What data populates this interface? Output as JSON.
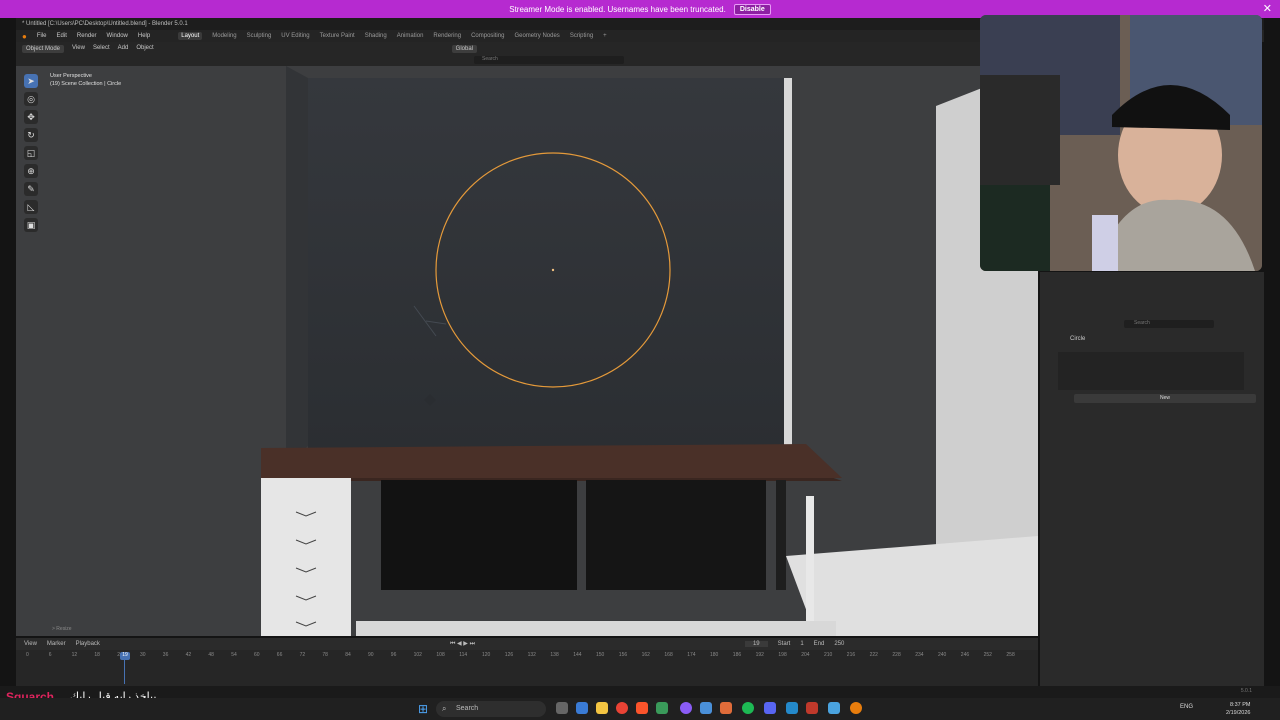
{
  "streamer": {
    "message": "Streamer Mode is enabled. Usernames have been truncated.",
    "disable_label": "Disable"
  },
  "window": {
    "title": "* Untitled [C:\\Users\\PC\\Desktop\\Untitled.blend] - Blender 5.0.1"
  },
  "menu": {
    "items": [
      "File",
      "Edit",
      "Render",
      "Window",
      "Help"
    ]
  },
  "workspaces": [
    "Layout",
    "Modeling",
    "Sculpting",
    "UV Editing",
    "Texture Paint",
    "Shading",
    "Animation",
    "Rendering",
    "Compositing",
    "Geometry Nodes",
    "Scripting"
  ],
  "viewport_header": {
    "mode": "Object Mode",
    "menus": [
      "View",
      "Select",
      "Add",
      "Object"
    ],
    "orientation": "Global",
    "search_placeholder": "Search"
  },
  "viewport": {
    "perspective": "User Perspective",
    "collection": "(19) Scene Collection | Circle",
    "bottom_label": "> Resize"
  },
  "properties": {
    "object_name": "Circle",
    "new_label": "New",
    "search_placeholder": "Search"
  },
  "timeline": {
    "menus": [
      "View",
      "Marker",
      "Playback"
    ],
    "current_frame": "19",
    "start_label": "Start",
    "start_value": "1",
    "end_label": "End",
    "end_value": "250",
    "ticks": [
      "0",
      "6",
      "12",
      "18",
      "24",
      "30",
      "36",
      "42",
      "48",
      "54",
      "60",
      "66",
      "72",
      "78",
      "84",
      "90",
      "96",
      "102",
      "108",
      "114",
      "120",
      "126",
      "132",
      "138",
      "144",
      "150",
      "156",
      "162",
      "168",
      "174",
      "180",
      "186",
      "192",
      "198",
      "204",
      "210",
      "216",
      "222",
      "228",
      "234",
      "240",
      "246",
      "252",
      "258"
    ]
  },
  "caption": {
    "arabic": "بياخذ رايه قبل رايك",
    "brand": "Squarch"
  },
  "taskbar": {
    "search_placeholder": "Search",
    "lang": "ENG",
    "time": "8:37 PM",
    "date": "2/19/2026"
  },
  "version": "5.0.1",
  "colors": {
    "streamer": "#b62ad0",
    "accent": "#4772b3",
    "selection": "#f0a040"
  }
}
